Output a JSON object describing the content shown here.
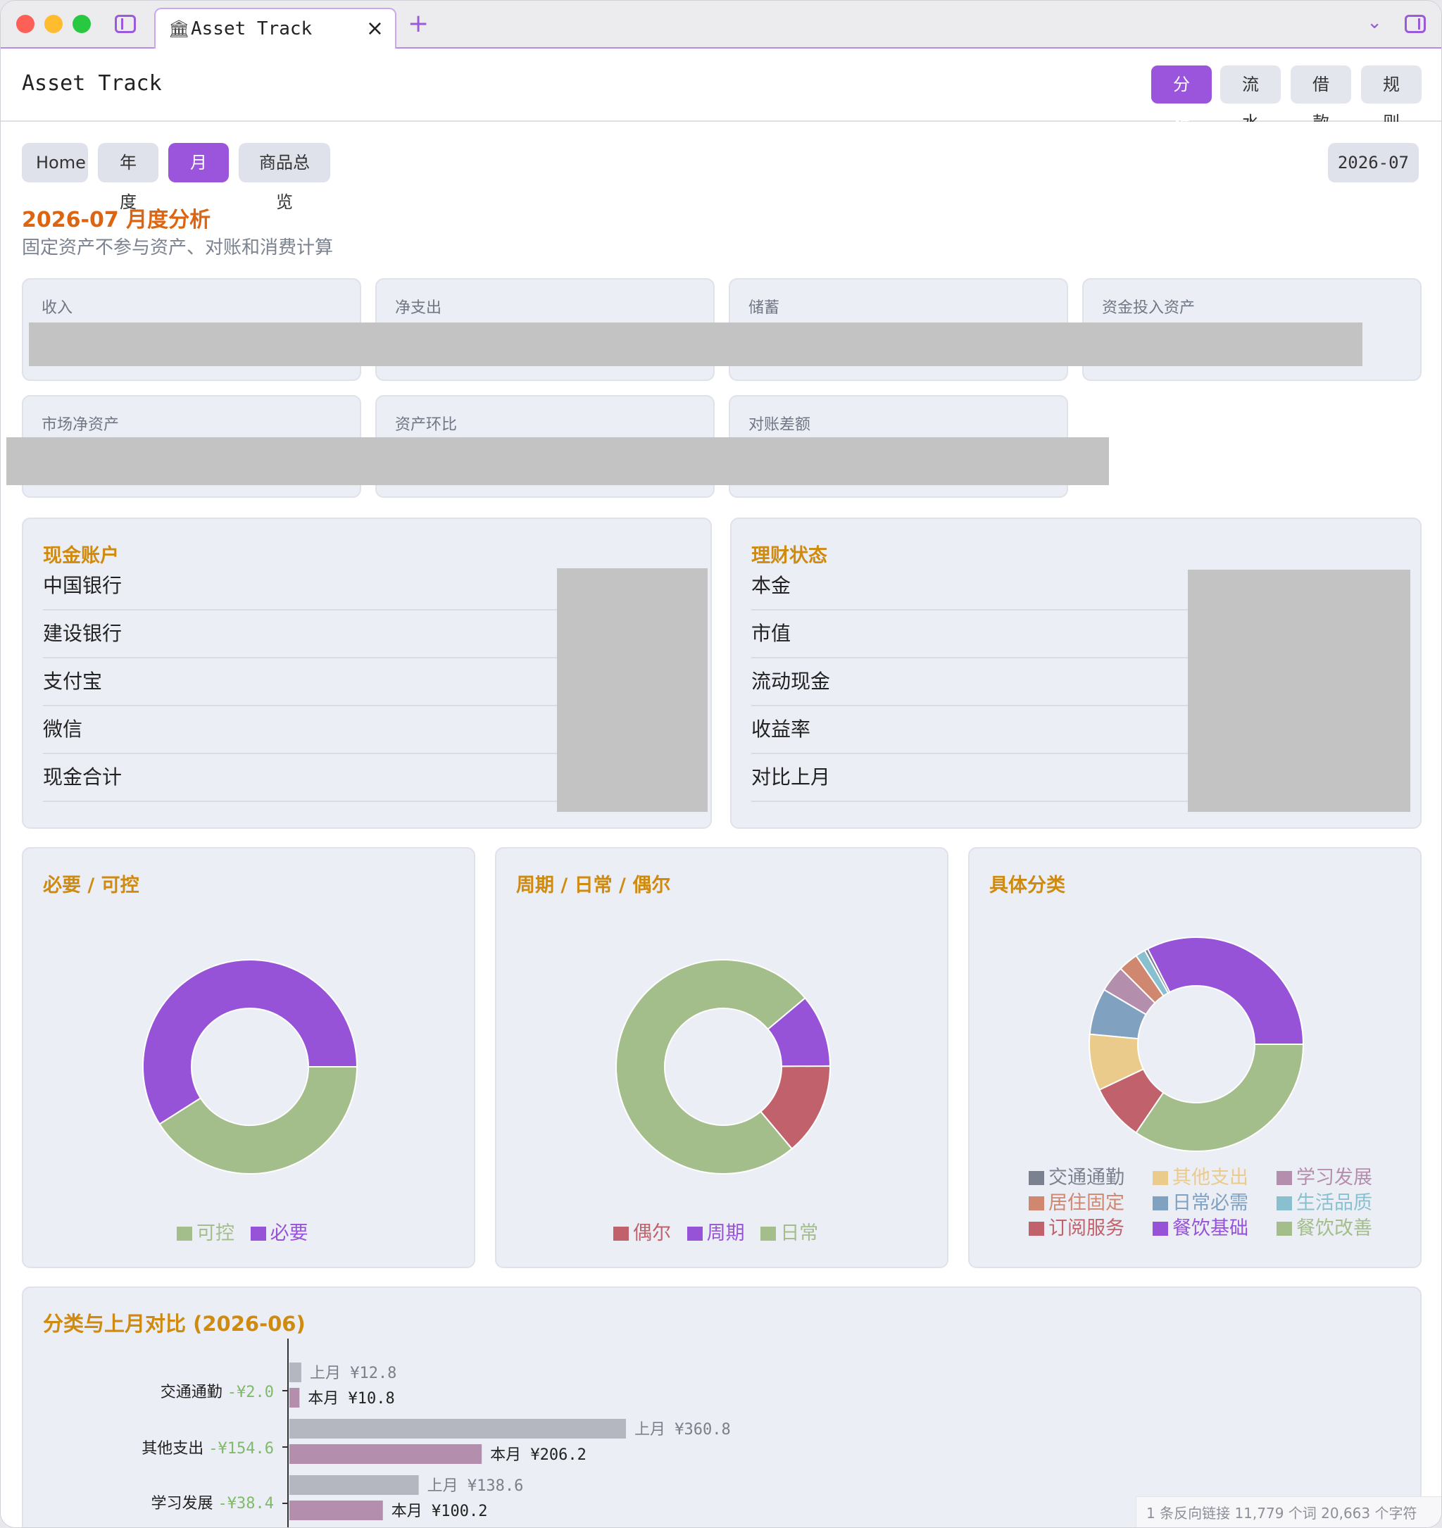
{
  "tab": {
    "icon": "bank-icon",
    "title": "Asset Track"
  },
  "app": {
    "title": "Asset Track"
  },
  "nav": [
    {
      "label": "分析",
      "active": true
    },
    {
      "label": "流水",
      "active": false
    },
    {
      "label": "借款",
      "active": false
    },
    {
      "label": "规则",
      "active": false
    }
  ],
  "subnav": [
    {
      "label": "Home",
      "active": false
    },
    {
      "label": "年度",
      "active": false
    },
    {
      "label": "月度",
      "active": true
    },
    {
      "label": "商品总览",
      "active": false
    }
  ],
  "month_picker": "2026-07",
  "page": {
    "title": "2026-07  月度分析",
    "subtitle": "固定资产不参与资产、对账和消费计算"
  },
  "stats": [
    "收入",
    "净支出",
    "储蓄",
    "资金投入资产",
    "市场净资产",
    "资产环比",
    "对账差额"
  ],
  "cash_panel": {
    "title": "现金账户",
    "rows": [
      "中国银行",
      "建设银行",
      "支付宝",
      "微信",
      "现金合计"
    ]
  },
  "invest_panel": {
    "title": "理财状态",
    "rows": [
      "本金",
      "市值",
      "流动现金",
      "收益率",
      "对比上月"
    ]
  },
  "colors": {
    "purple": "#9653d8",
    "green": "#a3bd8b",
    "red": "#c0616b",
    "yellow": "#ebcb8b",
    "blue": "#81a1c1",
    "mauve": "#b48ead",
    "orange": "#d08770",
    "teal": "#88c0d0",
    "gray": "#7b818f",
    "bar_prev": "#b4b7c0",
    "bar_curr": "#b48ead"
  },
  "chart_data": [
    {
      "type": "pie",
      "title": "必要 / 可控",
      "legend": [
        "可控",
        "必要"
      ],
      "slices": [
        {
          "name": "必要",
          "value": 59,
          "color": "#9653d8"
        },
        {
          "name": "可控",
          "value": 41,
          "color": "#a3bd8b"
        }
      ]
    },
    {
      "type": "pie",
      "title": "周期 / 日常 / 偶尔",
      "legend": [
        "偶尔",
        "周期",
        "日常"
      ],
      "slices": [
        {
          "name": "周期",
          "value": 11,
          "color": "#9653d8"
        },
        {
          "name": "偶尔",
          "value": 14,
          "color": "#c0616b"
        },
        {
          "name": "日常",
          "value": 75,
          "color": "#a3bd8b"
        }
      ]
    },
    {
      "type": "pie",
      "title": "具体分类",
      "legend": [
        "交通通勤",
        "其他支出",
        "学习发展",
        "居住固定",
        "日常必需",
        "生活品质",
        "订阅服务",
        "餐饮基础",
        "餐饮改善"
      ],
      "slices": [
        {
          "name": "餐饮基础",
          "value": 32.5,
          "color": "#9653d8"
        },
        {
          "name": "交通通勤",
          "value": 0.5,
          "color": "#7b818f"
        },
        {
          "name": "生活品质",
          "value": 1.5,
          "color": "#88c0d0"
        },
        {
          "name": "居住固定",
          "value": 3,
          "color": "#d08770"
        },
        {
          "name": "学习发展",
          "value": 4,
          "color": "#b48ead"
        },
        {
          "name": "日常必需",
          "value": 7,
          "color": "#81a1c1"
        },
        {
          "name": "其他支出",
          "value": 8.5,
          "color": "#ebcb8b"
        },
        {
          "name": "订阅服务",
          "value": 8.5,
          "color": "#c0616b"
        },
        {
          "name": "餐饮改善",
          "value": 34.5,
          "color": "#a3bd8b"
        }
      ]
    },
    {
      "type": "bar",
      "title": "分类与上月对比 (2026-06)",
      "categories": [
        "交通通勤",
        "其他支出",
        "学习发展"
      ],
      "diffs": [
        "-¥2.0",
        "-¥154.6",
        "-¥38.4"
      ],
      "series": [
        {
          "name": "上月",
          "values": [
            12.8,
            360.8,
            138.6
          ],
          "labels": [
            "上月 ¥12.8",
            "上月 ¥360.8",
            "上月 ¥138.6"
          ]
        },
        {
          "name": "本月",
          "values": [
            10.8,
            206.2,
            100.2
          ],
          "labels": [
            "本月 ¥10.8",
            "本月 ¥206.2",
            "本月 ¥100.2"
          ]
        }
      ]
    }
  ],
  "status_bar": "1 条反向链接  11,779 个词  20,663 个字符"
}
